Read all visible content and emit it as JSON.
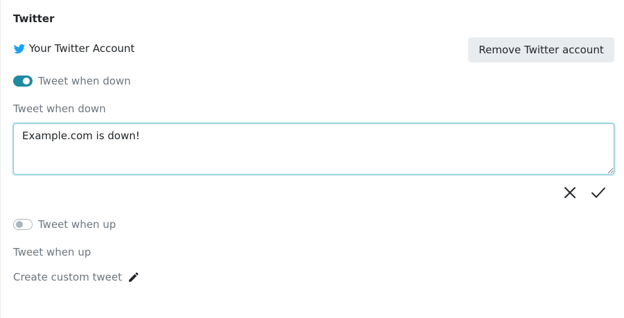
{
  "section": {
    "title": "Twitter"
  },
  "account": {
    "label": "Your Twitter Account",
    "icon": "twitter-bird-icon",
    "remove_button": "Remove Twitter account"
  },
  "tweet_down": {
    "toggle_label": "Tweet when down",
    "toggle_on": true,
    "field_label": "Tweet when down",
    "value": "Example.com is down!"
  },
  "tweet_up": {
    "toggle_label": "Tweet when up",
    "toggle_on": false,
    "field_label": "Tweet when up"
  },
  "custom": {
    "label": "Create custom tweet",
    "icon": "pencil-icon"
  },
  "actions": {
    "cancel_icon": "close-icon",
    "save_icon": "checkmark-icon"
  },
  "colors": {
    "accent": "#1f8aa1",
    "twitter_blue": "#1da1f2",
    "button_bg": "#e9ecef",
    "muted_text": "#6c757d"
  }
}
